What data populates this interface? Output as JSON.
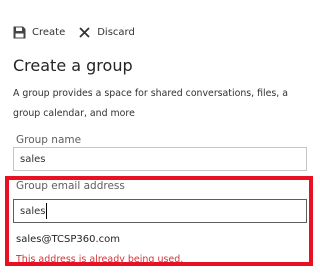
{
  "toolbar": {
    "create_label": "Create",
    "create_icon": "save-icon",
    "discard_label": "Discard",
    "discard_icon": "close-icon"
  },
  "form": {
    "title": "Create a group",
    "description": "A group provides a space for shared conversations, files, a group calendar, and more",
    "group_name": {
      "label": "Group name",
      "value": "sales"
    },
    "group_email": {
      "label": "Group email address",
      "value": "sales",
      "full_address": "sales@TCSP360.com",
      "error": "This address is already being used."
    }
  },
  "colors": {
    "highlight_border": "#e81123",
    "error_text": "#d13438"
  }
}
